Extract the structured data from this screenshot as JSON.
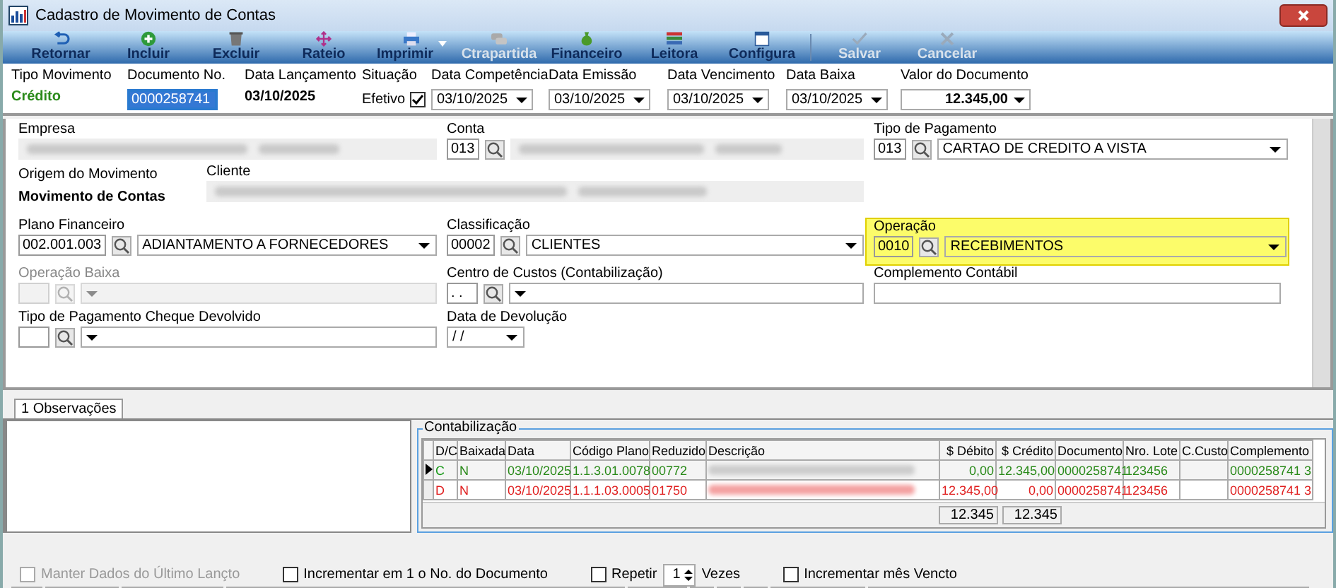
{
  "window": {
    "title": "Cadastro de Movimento de Contas"
  },
  "toolbar": [
    {
      "label": "Retornar",
      "disabled": false,
      "menu": false
    },
    {
      "label": "Incluir",
      "disabled": false,
      "menu": false
    },
    {
      "label": "Excluir",
      "disabled": false,
      "menu": false
    },
    {
      "label": "Rateio",
      "disabled": false,
      "menu": false
    },
    {
      "label": "Imprimir",
      "disabled": false,
      "menu": true
    },
    {
      "label": "Ctrapartida",
      "disabled": true,
      "menu": false
    },
    {
      "label": "Financeiro",
      "disabled": false,
      "menu": false
    },
    {
      "label": "Leitora",
      "disabled": false,
      "menu": false
    },
    {
      "label": "Configura",
      "disabled": false,
      "menu": false
    },
    {
      "label": "Salvar",
      "disabled": true,
      "menu": false
    },
    {
      "label": "Cancelar",
      "disabled": true,
      "menu": false
    }
  ],
  "header": [
    {
      "kind": "status",
      "label": "Tipo Movimento",
      "value": "Crédito"
    },
    {
      "kind": "input",
      "label": "Documento No.",
      "value": "0000258741"
    },
    {
      "kind": "bold",
      "label": "Data Lançamento",
      "value": "03/10/2025"
    },
    {
      "kind": "check",
      "label": "Situação",
      "value": "Efetivo",
      "checked": true
    },
    {
      "kind": "date",
      "label": "Data Competência",
      "value": "03/10/2025"
    },
    {
      "kind": "date",
      "label": "Data Emissão",
      "value": "03/10/2025"
    },
    {
      "kind": "date",
      "label": "Data Vencimento",
      "value": "03/10/2025"
    },
    {
      "kind": "date",
      "label": "Data Baixa",
      "value": "03/10/2025"
    },
    {
      "kind": "amount",
      "label": "Valor do Documento",
      "value": "12.345,00"
    }
  ],
  "form": [
    [
      {
        "label": "Empresa",
        "kind": "blurred",
        "disabled": false,
        "highlighted": false
      },
      {
        "label": "Conta",
        "kind": "lookup-blurred",
        "code": "013",
        "disabled": false,
        "highlighted": false
      },
      {
        "label": "Tipo de Pagamento",
        "kind": "lookup-combo",
        "code": "013",
        "value": "CARTAO DE CREDITO A VISTA",
        "disabled": false,
        "highlighted": false
      }
    ],
    [
      {
        "label": "Origem do Movimento",
        "kind": "static",
        "value": "Movimento de Contas",
        "disabled": false,
        "highlighted": false
      },
      {
        "label": "Cliente",
        "kind": "blurred",
        "disabled": false,
        "highlighted": false
      }
    ],
    [
      {
        "label": "Plano Financeiro",
        "kind": "lookup-combo",
        "code": "002.001.003",
        "value": "ADIANTAMENTO A FORNECEDORES",
        "disabled": false,
        "highlighted": false
      },
      {
        "label": "Classificação",
        "kind": "lookup-combo",
        "code": "00002",
        "value": "CLIENTES",
        "disabled": false,
        "highlighted": false
      },
      {
        "label": "Operação",
        "kind": "lookup-combo",
        "code": "0010",
        "value": "RECEBIMENTOS",
        "disabled": false,
        "highlighted": true
      }
    ],
    [
      {
        "label": "Operação Baixa",
        "kind": "lookup-combo",
        "disabled": true,
        "highlighted": false
      },
      {
        "label": "Centro de Custos (Contabilização)",
        "kind": "lookup-combo",
        "code": ". .",
        "disabled": false,
        "highlighted": false
      },
      {
        "label": "Complemento Contábil",
        "kind": "text",
        "disabled": false,
        "highlighted": false
      }
    ],
    [
      {
        "label": "Tipo de Pagamento Cheque Devolvido",
        "kind": "lookup-combo",
        "disabled": false,
        "highlighted": false
      },
      {
        "label": "Data de Devolução",
        "kind": "date",
        "value": "/ /",
        "disabled": false,
        "highlighted": false
      }
    ]
  ],
  "tabs": [
    {
      "label": "1 Observações",
      "selected": true
    }
  ],
  "accounting": {
    "title": "Contabilização",
    "columns": [
      "D/C",
      "Baixada",
      "Data",
      "Código Plano",
      "Reduzido",
      "Descrição",
      "$ Débito",
      "$ Crédito",
      "Documento",
      "Nro. Lote",
      "C.Custo",
      "Complemento"
    ],
    "rows": [
      {
        "kind": "credit",
        "current": true,
        "cells": [
          "C",
          "N",
          "03/10/2025",
          "1.1.3.01.0078",
          "00772",
          "",
          "0,00",
          "12.345,00",
          "0000258741",
          "123456",
          "",
          "0000258741 3"
        ]
      },
      {
        "kind": "debit",
        "current": false,
        "cells": [
          "D",
          "N",
          "03/10/2025",
          "1.1.1.03.0005",
          "01750",
          "",
          "12.345,00",
          "0,00",
          "0000258741",
          "123456",
          "",
          "0000258741 3"
        ]
      }
    ],
    "totals": [
      "12.345",
      "12.345"
    ]
  },
  "options": [
    {
      "kind": "check",
      "label": "Manter Dados do Último Lançto",
      "checked": false,
      "disabled": true
    },
    {
      "kind": "check",
      "label": "Incrementar em 1 o No. do Documento",
      "checked": false,
      "disabled": false
    },
    {
      "kind": "repeat",
      "label": "Repetir",
      "value": "1",
      "suffix": "Vezes",
      "checked": false,
      "disabled": false
    },
    {
      "kind": "check",
      "label": "Incrementar mês Vencto",
      "checked": false,
      "disabled": false
    }
  ]
}
